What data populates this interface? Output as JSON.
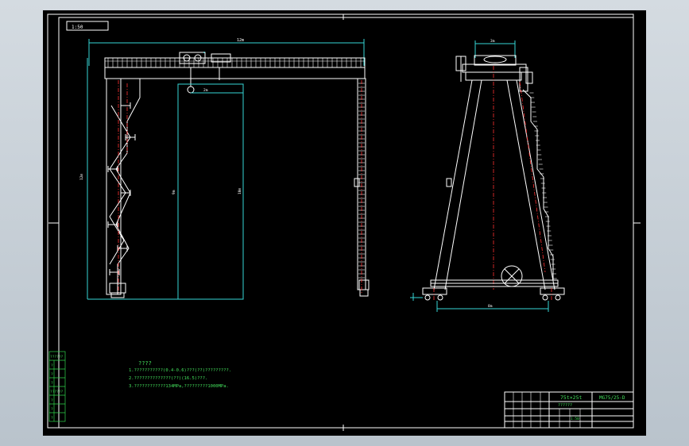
{
  "sheet": {
    "scale_label": "1:50",
    "top_dimension": "12m",
    "bottom_dimension": "8m",
    "trolley_dimension": "2m",
    "left_height": "12m",
    "inner_height": "9m",
    "mid_height": "10m",
    "side_top_dimension": "3m"
  },
  "notes": {
    "title": "????",
    "line1": "1.???????????(0.4-0.6)???(??)?????????.",
    "line2": "2.??????????????(??)(16.5)???.",
    "line3": "3.????????????134MPa,?????????1000MPa."
  },
  "left_table": {
    "header1": "??????",
    "header2": "??????",
    "row_marks": [
      "?",
      "?",
      "?",
      "?",
      "?",
      "?"
    ]
  },
  "title_block": {
    "name": "75t×25t",
    "subtitle": "??????",
    "drawing_no": "MG75/25-D",
    "scale_row": "1:50"
  }
}
